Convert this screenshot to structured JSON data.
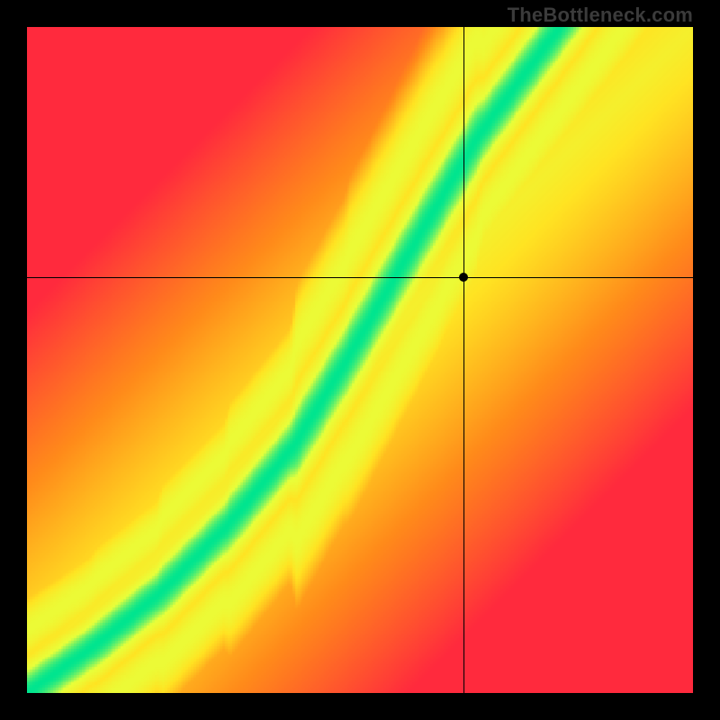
{
  "watermark": "TheBottleneck.com",
  "chart_data": {
    "type": "heatmap",
    "title": "",
    "xlabel": "",
    "ylabel": "",
    "xlim": [
      0,
      1
    ],
    "ylim": [
      0,
      1
    ],
    "grid": false,
    "legend": "none",
    "colorscale": [
      {
        "stop": 0.0,
        "color": "#ff2a3d"
      },
      {
        "stop": 0.4,
        "color": "#ff8a1a"
      },
      {
        "stop": 0.7,
        "color": "#ffe322"
      },
      {
        "stop": 0.88,
        "color": "#e8ff3a"
      },
      {
        "stop": 1.0,
        "color": "#00e58f"
      }
    ],
    "ridge_control_points": [
      {
        "x": 0.0,
        "y": 0.0
      },
      {
        "x": 0.1,
        "y": 0.07
      },
      {
        "x": 0.2,
        "y": 0.15
      },
      {
        "x": 0.3,
        "y": 0.25
      },
      {
        "x": 0.4,
        "y": 0.37
      },
      {
        "x": 0.48,
        "y": 0.5
      },
      {
        "x": 0.55,
        "y": 0.62
      },
      {
        "x": 0.62,
        "y": 0.74
      },
      {
        "x": 0.68,
        "y": 0.84
      },
      {
        "x": 0.74,
        "y": 0.92
      },
      {
        "x": 0.8,
        "y": 1.0
      }
    ],
    "ridge_half_width": 0.055,
    "crosshair": {
      "x": 0.655,
      "y": 0.625
    },
    "marker": {
      "x": 0.655,
      "y": 0.625
    },
    "resolution": 256
  }
}
